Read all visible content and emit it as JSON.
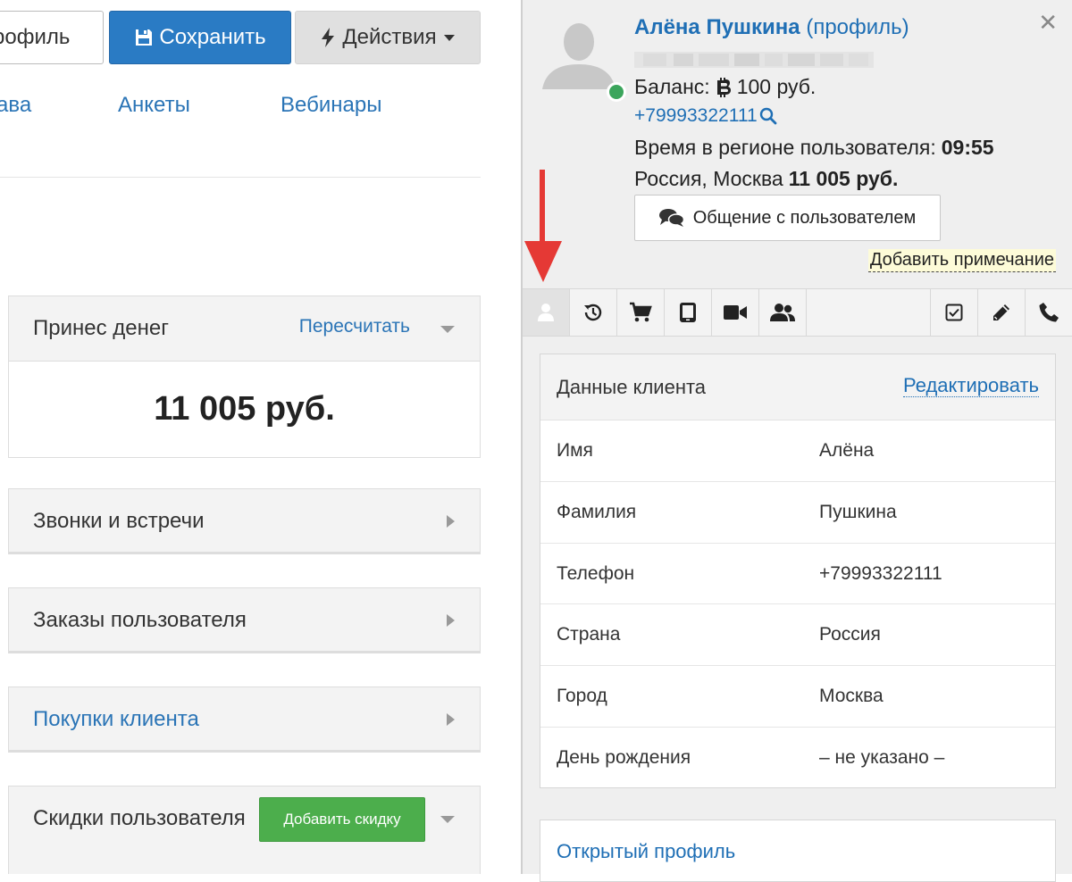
{
  "toolbar": {
    "profile_label": "профиль",
    "save_label": "Сохранить",
    "actions_label": "Действия"
  },
  "tabs": [
    "ава",
    "Анкеты",
    "Вебинары"
  ],
  "panels": {
    "money": {
      "title": "Принес денег",
      "recalc": "Пересчитать",
      "amount": "11 005 руб."
    },
    "calls": {
      "title": "Звонки и встречи"
    },
    "orders": {
      "title": "Заказы пользователя"
    },
    "purchases": {
      "title": "Покупки клиента"
    },
    "discounts": {
      "title": "Скидки пользователя",
      "add_button": "Добавить скидку"
    }
  },
  "drawer": {
    "name": "Алёна Пушкина",
    "profile_link": "(профиль)",
    "balance_label": "Баланс:",
    "balance_value": "100 руб.",
    "phone": "+79993322111",
    "time_label": "Время в регионе пользователя:",
    "time_value": "09:55",
    "location": "Россия, Москва",
    "total": "11 005 руб.",
    "chat_button": "Общение с пользователем",
    "add_note": "Добавить примечание"
  },
  "client_card": {
    "title": "Данные клиента",
    "edit": "Редактировать",
    "rows": [
      {
        "label": "Имя",
        "value": "Алёна"
      },
      {
        "label": "Фамилия",
        "value": "Пушкина"
      },
      {
        "label": "Телефон",
        "value": "+79993322111"
      },
      {
        "label": "Страна",
        "value": "Россия"
      },
      {
        "label": "Город",
        "value": "Москва"
      },
      {
        "label": "День рождения",
        "value": "– не указано –"
      }
    ]
  },
  "open_profile": "Открытый профиль",
  "colors": {
    "primary": "#2a7bc4",
    "link": "#1f6fb5",
    "success": "#4cae4c",
    "online": "#3ba55c",
    "arrow": "#e53935"
  },
  "icons": [
    "save-icon",
    "bolt-icon",
    "bitcoin-icon",
    "search-icon",
    "chat-icon",
    "user-icon",
    "history-icon",
    "cart-icon",
    "tablet-icon",
    "video-icon",
    "users-icon",
    "checkbox-icon",
    "pencil-icon",
    "phone-icon",
    "close-icon"
  ]
}
